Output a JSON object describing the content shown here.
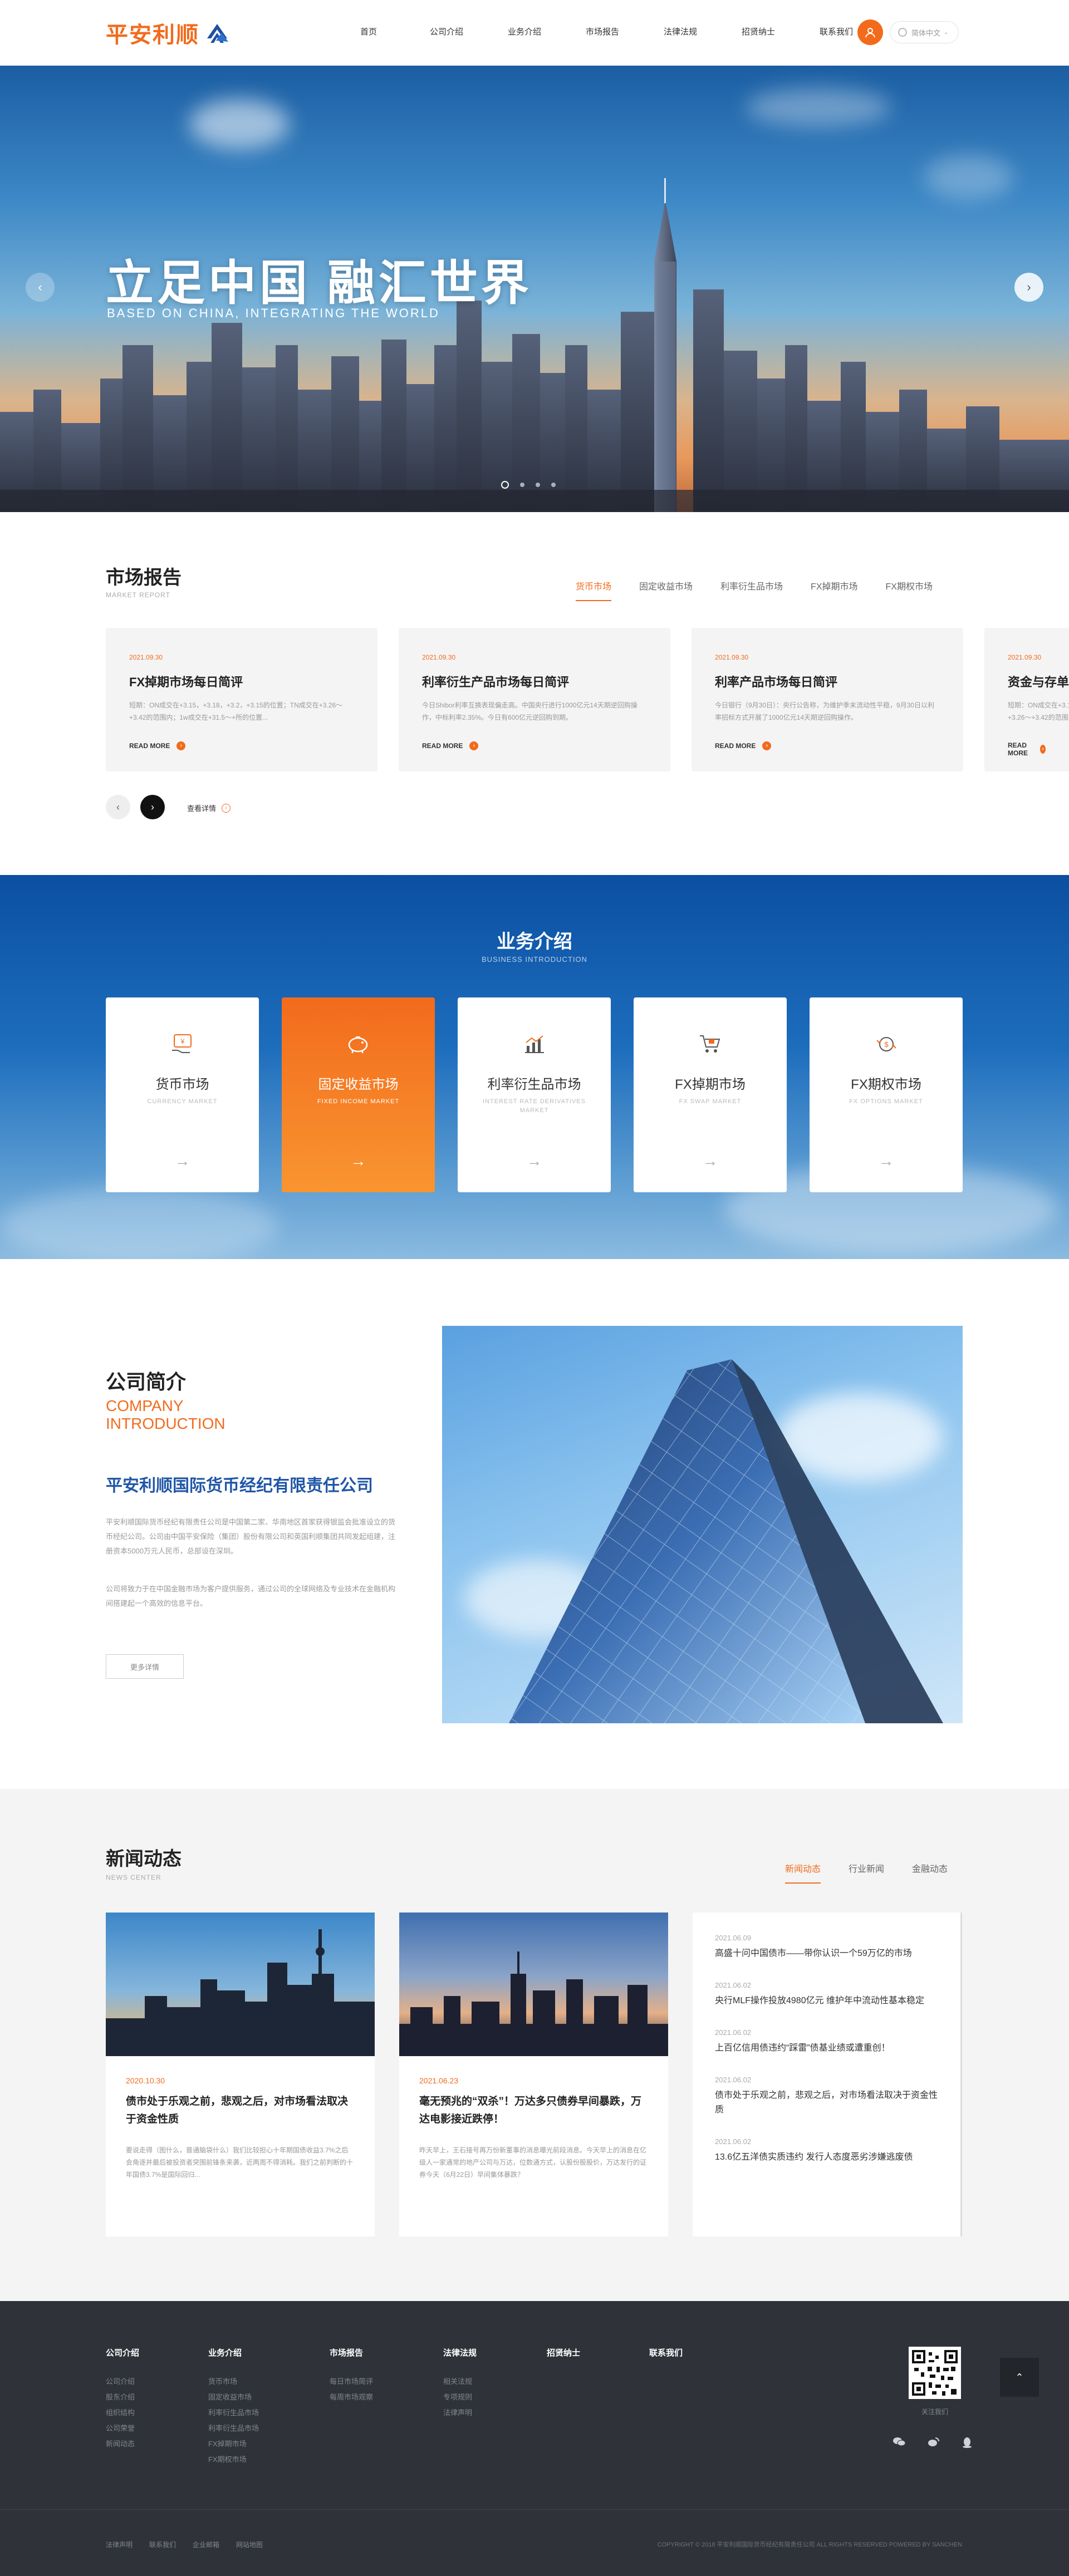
{
  "header": {
    "logo_text": "平安利顺",
    "nav": [
      "首页",
      "公司介绍",
      "业务介绍",
      "市场报告",
      "法律法规",
      "招贤纳士",
      "联系我们"
    ],
    "language": "简体中文"
  },
  "banner": {
    "title": "立足中国 融汇世界",
    "subtitle": "BASED ON CHINA, INTEGRATING THE WORLD",
    "prev": "‹",
    "next": "›"
  },
  "market": {
    "title": "市场报告",
    "subtitle": "MARKET REPORT",
    "tabs": [
      "货币市场",
      "固定收益市场",
      "利率衍生品市场",
      "FX掉期市场",
      "FX期权市场"
    ],
    "cards": [
      {
        "date": "2021.09.30",
        "title": "FX掉期市场每日简评",
        "desc": "短期：ON成交在+3.15，+3.18，+3.2，+3.15的位置；TN成交在+3.26～+3.42的范围内；1w成交在+31.5～+所的位置...",
        "more": "READ MORE"
      },
      {
        "date": "2021.09.30",
        "title": "利率衍生产品市场每日简评",
        "desc": "今日Shibor利率互换表现偏走高。中国央行进行1000亿元14天期逆回购操作，中标利率2.35%。今日有600亿元逆回购到期。",
        "more": "READ MORE"
      },
      {
        "date": "2021.09.30",
        "title": "利率产品市场每日简评",
        "desc": "今日银行（9月30日）：央行公告称，为维护季末流动性平稳，9月30日以利率招标方式开展了1000亿元14天期逆回购操作。",
        "more": "READ MORE"
      },
      {
        "date": "2021.09.30",
        "title": "资金与存单",
        "desc": "短期：ON成交在+3.15～+3.26～+3.42的范围内",
        "more": "READ MORE"
      }
    ],
    "view_more": "查看详情"
  },
  "business": {
    "title": "业务介绍",
    "subtitle": "BUSINESS INTRODUCTION",
    "cards": [
      {
        "name": "货币市场",
        "en": "CURRENCY MARKET"
      },
      {
        "name": "固定收益市场",
        "en": "FIXED INCOME MARKET"
      },
      {
        "name": "利率衍生品市场",
        "en": "INTEREST RATE DERIVATIVES MARKET"
      },
      {
        "name": "FX掉期市场",
        "en": "FX SWAP MARKET"
      },
      {
        "name": "FX期权市场",
        "en": "FX OPTIONS MARKET"
      }
    ],
    "arrow": "→"
  },
  "company": {
    "title": "公司简介",
    "en_line1": "COMPANY",
    "en_line2": "INTRODUCTION",
    "name": "平安利顺国际货币经纪有限责任公司",
    "p1": "平安利顺国际货币经纪有限责任公司是中国第二家、华南地区首家获得银监会批准设立的货币经纪公司。公司由中国平安保险（集团）股份有限公司和英国利顺集团共同发起组建，注册资本5000万元人民币，总部设在深圳。",
    "p2": "公司将致力于在中国金融市场为客户提供服务，通过公司的全球网络及专业技术在金融机构间搭建起一个高效的信息平台。",
    "more": "更多详情"
  },
  "news": {
    "title": "新闻动态",
    "subtitle": "NEWS CENTER",
    "tabs": [
      "新闻动态",
      "行业新闻",
      "金融动态"
    ],
    "cards": [
      {
        "date": "2020.10.30",
        "title": "债市处于乐观之前，悲观之后，对市场看法取决于资金性质",
        "desc": "要说走得（图什么，普通脑袋什么）我们比较担心十年期国债收益3.7%之后会角逐并最后被投资者突围前锋条来袭，近两周不得消耗。我们之前判断的十年国债3.7%是国际回归..."
      },
      {
        "date": "2021.06.23",
        "title": "毫无预兆的“双杀”！万达多只债券早间暴跌，万达电影接近跌停！",
        "desc": "昨天早上，王石接号再万份新董事的消息曝光前段消息。今天早上的消息在亿级人一家通常的地产公司与万达，位数通方式，认股份股股价，万达发行的证券今天（6月22日）早间集体暴跌？"
      }
    ],
    "list": [
      {
        "date": "2021.06.09",
        "title": "高盛十问中国债市——带你认识一个59万亿的市场"
      },
      {
        "date": "2021.06.02",
        "title": "央行MLF操作投放4980亿元 维护年中流动性基本稳定"
      },
      {
        "date": "2021.06.02",
        "title": "上百亿信用债违约“踩雷”债基业绩或遭重创！"
      },
      {
        "date": "2021.06.02",
        "title": "债市处于乐观之前，悲观之后，对市场看法取决于资金性质"
      },
      {
        "date": "2021.06.02",
        "title": "13.6亿五洋债实质违约 发行人态度恶劣涉嫌逃废债"
      }
    ]
  },
  "footer": {
    "cols": [
      {
        "h": "公司介绍",
        "items": [
          "公司介绍",
          "股东介绍",
          "组织结构",
          "公司荣誉",
          "新闻动态"
        ]
      },
      {
        "h": "业务介绍",
        "items": [
          "货币市场",
          "固定收益市场",
          "利率衍生品市场",
          "利率衍生品市场",
          "FX掉期市场",
          "FX期权市场"
        ]
      },
      {
        "h": "市场报告",
        "items": [
          "每日市场简评",
          "每周市场观察"
        ]
      },
      {
        "h": "法律法规",
        "items": [
          "相关法规",
          "专项规则",
          "法律声明"
        ]
      },
      {
        "h": "招贤纳士",
        "items": []
      },
      {
        "h": "联系我们",
        "items": []
      }
    ],
    "qr_label": "关注我们",
    "bottom_links": [
      "法律声明",
      "联系我们",
      "企业邮箱",
      "网站地图"
    ],
    "copyright": "COPYRIGHT © 2018 平安利顺国际货币经纪有限责任公司 ALL RIGHTS RESERVED  POWERED BY SANCHEN"
  },
  "colors": {
    "accent": "#f26b1d",
    "footer": "#2f3339",
    "grey_bg": "#f4f4f4"
  }
}
